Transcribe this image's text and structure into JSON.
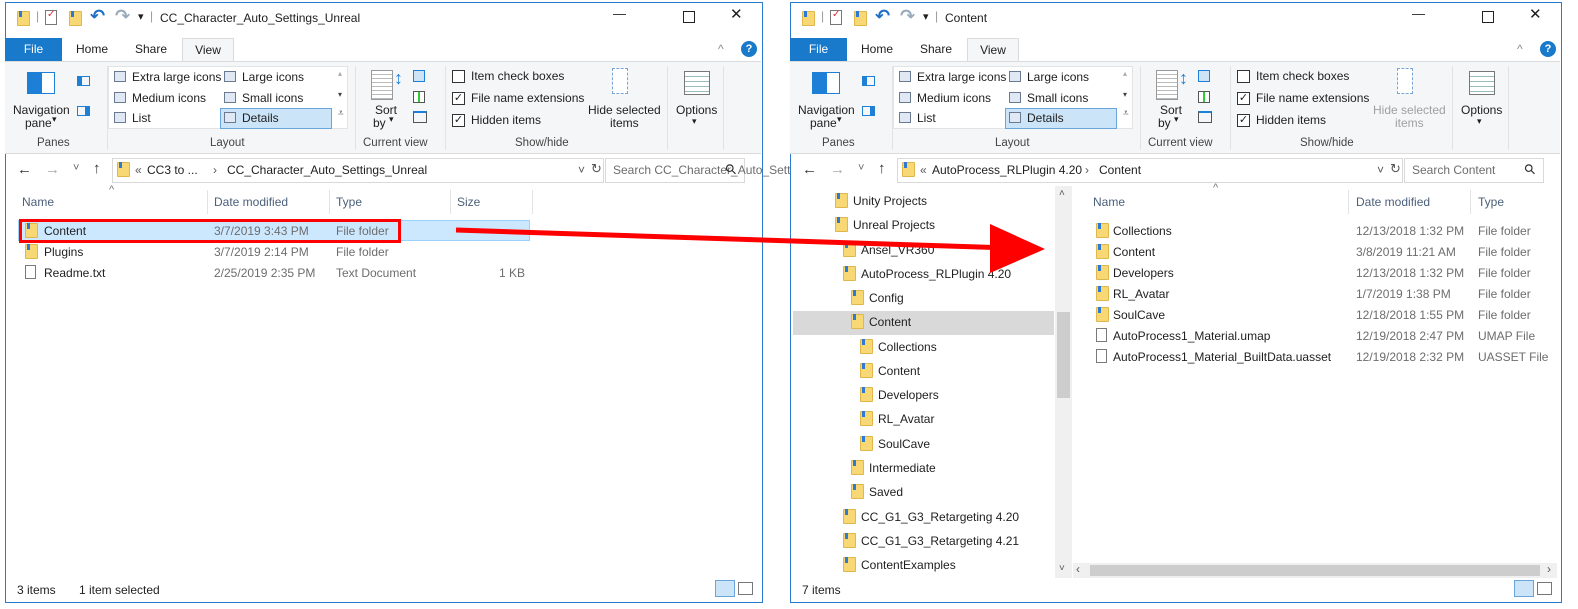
{
  "accent": "#1979ca",
  "highlight_color": "#ff0000",
  "left": {
    "title": "CC_Character_Auto_Settings_Unreal",
    "tabs": [
      "File",
      "Home",
      "Share",
      "View"
    ],
    "active_tab": "View",
    "ribbon": {
      "panes": {
        "nav_pane": "Navigation",
        "nav_pane2": "pane",
        "label": "Panes"
      },
      "layout": {
        "items": [
          "Extra large icons",
          "Large icons",
          "Medium icons",
          "Small icons",
          "List",
          "Details"
        ],
        "selected": "Details",
        "label": "Layout"
      },
      "current_view": {
        "sort": "Sort",
        "sort2": "by",
        "label": "Current view"
      },
      "show_hide": {
        "checks": [
          {
            "label": "Item check boxes",
            "checked": false
          },
          {
            "label": "File name extensions",
            "checked": true
          },
          {
            "label": "Hidden items",
            "checked": true
          }
        ],
        "hide1": "Hide selected",
        "hide2": "items",
        "label": "Show/hide"
      },
      "options": "Options"
    },
    "address": {
      "prefix": "CC3 to ...",
      "current": "CC_Character_Auto_Settings_Unreal"
    },
    "search_placeholder": "Search CC_Character_Auto_Settings_...",
    "columns": [
      "Name",
      "Date modified",
      "Type",
      "Size"
    ],
    "rows": [
      {
        "name": "Content",
        "date": "3/7/2019 3:43 PM",
        "type": "File folder",
        "size": "",
        "icon": "folder",
        "selected": true
      },
      {
        "name": "Plugins",
        "date": "3/7/2019 2:14 PM",
        "type": "File folder",
        "size": "",
        "icon": "folder"
      },
      {
        "name": "Readme.txt",
        "date": "2/25/2019 2:35 PM",
        "type": "Text Document",
        "size": "1 KB",
        "icon": "text-file"
      }
    ],
    "status": {
      "count": "3 items",
      "selection": "1 item selected"
    }
  },
  "right": {
    "title": "Content",
    "tabs": [
      "File",
      "Home",
      "Share",
      "View"
    ],
    "active_tab": "View",
    "ribbon": {
      "panes": {
        "nav_pane": "Navigation",
        "nav_pane2": "pane",
        "label": "Panes"
      },
      "layout": {
        "items": [
          "Extra large icons",
          "Large icons",
          "Medium icons",
          "Small icons",
          "List",
          "Details"
        ],
        "selected": "Details",
        "label": "Layout"
      },
      "current_view": {
        "sort": "Sort",
        "sort2": "by",
        "label": "Current view"
      },
      "show_hide": {
        "checks": [
          {
            "label": "Item check boxes",
            "checked": false
          },
          {
            "label": "File name extensions",
            "checked": true
          },
          {
            "label": "Hidden items",
            "checked": true
          }
        ],
        "hide1": "Hide selected",
        "hide2": "items",
        "label": "Show/hide"
      },
      "options": "Options"
    },
    "address": {
      "prefix": "AutoProcess_RLPlugin 4.20",
      "current": "Content"
    },
    "search_placeholder": "Search Content",
    "tree": [
      {
        "label": "Unity Projects",
        "level": 0
      },
      {
        "label": "Unreal Projects",
        "level": 0
      },
      {
        "label": "Ansel_VR360",
        "level": 1
      },
      {
        "label": "AutoProcess_RLPlugin 4.20",
        "level": 1
      },
      {
        "label": "Config",
        "level": 2
      },
      {
        "label": "Content",
        "level": 2,
        "selected": true
      },
      {
        "label": "Collections",
        "level": 3
      },
      {
        "label": "Content",
        "level": 3
      },
      {
        "label": "Developers",
        "level": 3
      },
      {
        "label": "RL_Avatar",
        "level": 3
      },
      {
        "label": "SoulCave",
        "level": 3
      },
      {
        "label": "Intermediate",
        "level": 2
      },
      {
        "label": "Saved",
        "level": 2
      },
      {
        "label": "CC_G1_G3_Retargeting 4.20",
        "level": 1
      },
      {
        "label": "CC_G1_G3_Retargeting 4.21",
        "level": 1
      },
      {
        "label": "ContentExamples",
        "level": 1
      }
    ],
    "columns": [
      "Name",
      "Date modified",
      "Type"
    ],
    "rows": [
      {
        "name": "Collections",
        "date": "12/13/2018 1:32 PM",
        "type": "File folder",
        "icon": "folder"
      },
      {
        "name": "Content",
        "date": "3/8/2019 11:21 AM",
        "type": "File folder",
        "icon": "folder"
      },
      {
        "name": "Developers",
        "date": "12/13/2018 1:32 PM",
        "type": "File folder",
        "icon": "folder"
      },
      {
        "name": "RL_Avatar",
        "date": "1/7/2019 1:38 PM",
        "type": "File folder",
        "icon": "folder"
      },
      {
        "name": "SoulCave",
        "date": "12/18/2018 1:55 PM",
        "type": "File folder",
        "icon": "folder"
      },
      {
        "name": "AutoProcess1_Material.umap",
        "date": "12/19/2018 2:47 PM",
        "type": "UMAP File",
        "icon": "file"
      },
      {
        "name": "AutoProcess1_Material_BuiltData.uasset",
        "date": "12/19/2018 2:32 PM",
        "type": "UASSET File",
        "icon": "file"
      }
    ],
    "status": {
      "count": "7 items"
    }
  }
}
